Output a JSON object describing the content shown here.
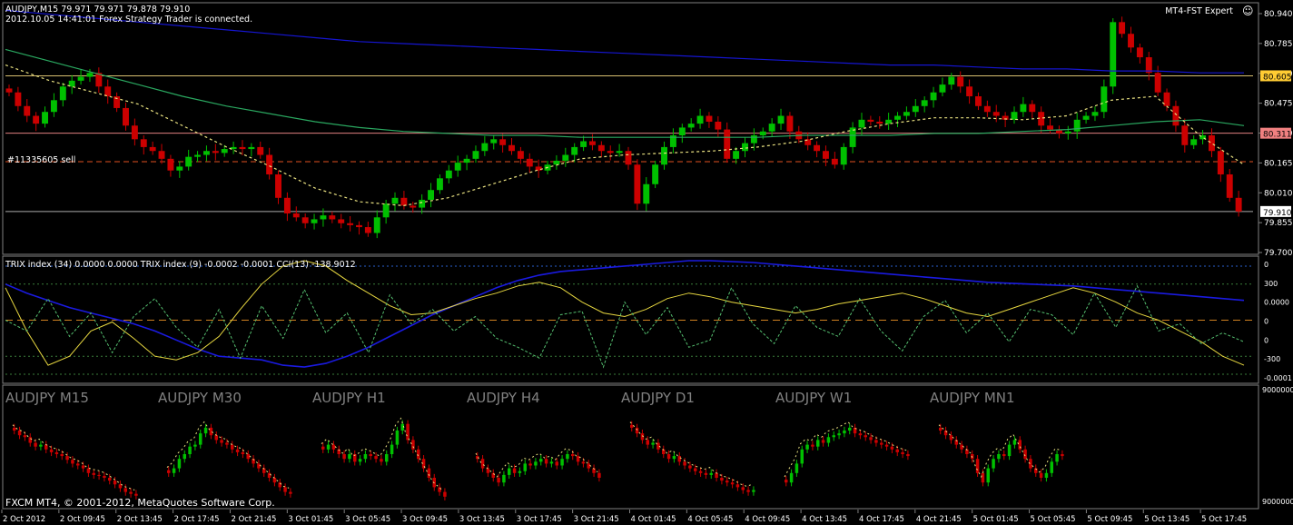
{
  "header": {
    "symbol_line": "AUDJPY,M15  79.971 79.971 79.878 79.910",
    "status_line": "2012.10.05 14:41:01 Forex Strategy Trader is connected.",
    "expert_label": "MT4-FST Expert",
    "smiley": "☺"
  },
  "chart_data": [
    {
      "type": "candlestick",
      "symbol": "AUDJPY",
      "timeframe": "M15",
      "price_axis": {
        "ylim": [
          79.7,
          80.97
        ],
        "ticks": [
          "80.940",
          "80.785",
          "80.630",
          "80.475",
          "80.320",
          "80.165",
          "80.010",
          "79.855",
          "79.700"
        ]
      },
      "price_tags": [
        {
          "value": "80.605",
          "color": "#ffcc33",
          "text_color": "#000000"
        },
        {
          "value": "80.311",
          "color": "#f08080",
          "text_color": "#000000"
        },
        {
          "value": "79.910",
          "color": "#ffffff",
          "text_color": "#000000"
        }
      ],
      "hlines": [
        {
          "price": 80.605,
          "color": "#d8c070"
        },
        {
          "price": 80.311,
          "color": "#e08080"
        },
        {
          "price": 80.165,
          "color": "#e05020",
          "dashed": true
        },
        {
          "price": 79.91,
          "color": "#aaaaaa"
        }
      ],
      "order_label": "#11335605 sell",
      "colors": {
        "up": "#00c000",
        "down": "#cc0000",
        "ma_slow": "#1515d0",
        "ma_mid": "#2aa860",
        "ma_fast": "#e8e080"
      },
      "bars_close": [
        80.52,
        80.45,
        80.4,
        80.36,
        80.42,
        80.48,
        80.55,
        80.58,
        80.6,
        80.62,
        80.55,
        80.5,
        80.44,
        80.35,
        80.28,
        80.24,
        80.22,
        80.18,
        80.12,
        80.14,
        80.19,
        80.2,
        80.22,
        80.21,
        80.23,
        80.24,
        80.23,
        80.24,
        80.2,
        80.1,
        79.98,
        79.9,
        79.88,
        79.85,
        79.87,
        79.89,
        79.87,
        79.85,
        79.84,
        79.83,
        79.8,
        79.88,
        79.95,
        79.98,
        79.94,
        79.93,
        79.97,
        80.02,
        80.08,
        80.12,
        80.16,
        80.18,
        80.22,
        80.26,
        80.28,
        80.25,
        80.22,
        80.18,
        80.14,
        80.12,
        80.15,
        80.17,
        80.2,
        80.24,
        80.27,
        80.25,
        80.22,
        80.21,
        80.22,
        80.15,
        79.95,
        80.05,
        80.15,
        80.24,
        80.3,
        80.34,
        80.36,
        80.4,
        80.37,
        80.33,
        80.18,
        80.22,
        80.26,
        80.3,
        80.32,
        80.36,
        80.4,
        80.32,
        80.28,
        80.25,
        80.22,
        80.18,
        80.15,
        80.24,
        80.34,
        80.38,
        80.37,
        80.36,
        80.38,
        80.4,
        80.42,
        80.45,
        80.48,
        80.52,
        80.56,
        80.6,
        80.55,
        80.5,
        80.45,
        80.42,
        80.4,
        80.38,
        80.42,
        80.46,
        80.42,
        80.35,
        80.33,
        80.31,
        80.32,
        80.38,
        80.4,
        80.42,
        80.55,
        80.88,
        80.82,
        80.75,
        80.7,
        80.62,
        80.52,
        80.45,
        80.35,
        80.25,
        80.28,
        80.3,
        80.22,
        80.1,
        79.98,
        79.91
      ],
      "ma_slow": [
        80.94,
        80.92,
        80.9,
        80.88,
        80.86,
        80.84,
        80.82,
        80.8,
        80.78,
        80.77,
        80.76,
        80.75,
        80.74,
        80.73,
        80.72,
        80.71,
        80.7,
        80.69,
        80.68,
        80.67,
        80.66,
        80.66,
        80.65,
        80.64,
        80.64,
        80.63,
        80.63,
        80.62,
        80.62
      ],
      "ma_mid": [
        80.74,
        80.68,
        80.62,
        80.56,
        80.5,
        80.45,
        80.41,
        80.37,
        80.34,
        80.32,
        80.31,
        80.3,
        80.3,
        80.29,
        80.29,
        80.29,
        80.29,
        80.29,
        80.3,
        80.3,
        80.3,
        80.31,
        80.31,
        80.32,
        80.33,
        80.35,
        80.37,
        80.38,
        80.35
      ],
      "ma_fast": [
        80.66,
        80.58,
        80.52,
        80.46,
        80.35,
        80.24,
        80.14,
        80.03,
        79.96,
        79.94,
        79.98,
        80.05,
        80.12,
        80.18,
        80.2,
        80.21,
        80.22,
        80.24,
        80.27,
        80.32,
        80.36,
        80.39,
        80.39,
        80.38,
        80.4,
        80.48,
        80.5,
        80.3,
        80.15
      ]
    },
    {
      "type": "line",
      "title": "TRIX index (34) 0.0000 0.0000  TRIX index (9) -0.0002 -0.0001  CCI(13) -138.9012",
      "right_axis_labels": [
        "0",
        "300",
        "0.0000",
        "0",
        "0",
        "-300",
        "-0.0001"
      ],
      "levels": [
        300,
        200,
        0,
        -200,
        -300
      ],
      "ylim": [
        -340,
        340
      ],
      "series": [
        {
          "name": "TRIX index (34)",
          "color": "#1a1ae0",
          "values": [
            200,
            150,
            110,
            70,
            40,
            10,
            -20,
            -60,
            -110,
            -160,
            -200,
            -210,
            -220,
            -250,
            -260,
            -240,
            -200,
            -150,
            -90,
            -30,
            30,
            80,
            130,
            180,
            220,
            250,
            270,
            280,
            290,
            300,
            310,
            320,
            330,
            330,
            325,
            320,
            310,
            300,
            290,
            280,
            270,
            260,
            250,
            240,
            230,
            220,
            210,
            205,
            200,
            195,
            190,
            180,
            170,
            160,
            150,
            140,
            130,
            120,
            110
          ]
        },
        {
          "name": "TRIX index (9)",
          "color": "#e8d840",
          "values": [
            180,
            -60,
            -250,
            -200,
            -60,
            -10,
            -100,
            -200,
            -220,
            -180,
            -90,
            60,
            200,
            300,
            330,
            300,
            220,
            150,
            80,
            30,
            40,
            80,
            120,
            150,
            190,
            210,
            180,
            100,
            40,
            20,
            60,
            120,
            150,
            130,
            100,
            80,
            60,
            40,
            60,
            90,
            110,
            130,
            150,
            120,
            80,
            40,
            20,
            60,
            100,
            140,
            180,
            150,
            100,
            40,
            0,
            -60,
            -120,
            -200,
            -250
          ]
        },
        {
          "name": "CCI(13)",
          "color": "#55c070",
          "values": [
            0,
            -60,
            120,
            -90,
            40,
            -180,
            20,
            120,
            -40,
            -150,
            60,
            -210,
            80,
            -100,
            170,
            -70,
            40,
            -180,
            140,
            -20,
            60,
            -60,
            20,
            -100,
            -150,
            -210,
            30,
            50,
            -260,
            100,
            -80,
            70,
            -150,
            -110,
            180,
            -20,
            -130,
            80,
            -40,
            -90,
            120,
            -60,
            -170,
            20,
            110,
            -70,
            40,
            -120,
            60,
            30,
            -80,
            150,
            -40,
            190,
            -60,
            -20,
            -130,
            -70,
            -120
          ]
        }
      ]
    },
    {
      "type": "candlestick",
      "title": "Multi-timeframe minicharts",
      "right_axis_labels": [
        "9000000",
        "9000000"
      ],
      "panels": [
        {
          "name": "AUDJPY M15",
          "closes": [
            0.75,
            0.7,
            0.68,
            0.62,
            0.58,
            0.6,
            0.55,
            0.52,
            0.5,
            0.48,
            0.44,
            0.4,
            0.38,
            0.35,
            0.3,
            0.28,
            0.27,
            0.25,
            0.22,
            0.18,
            0.14,
            0.1,
            0.08,
            0.06
          ]
        },
        {
          "name": "AUDJPY M30",
          "closes": [
            0.3,
            0.35,
            0.45,
            0.5,
            0.58,
            0.6,
            0.72,
            0.78,
            0.7,
            0.65,
            0.62,
            0.6,
            0.55,
            0.52,
            0.5,
            0.45,
            0.4,
            0.35,
            0.3,
            0.25,
            0.2,
            0.15,
            0.1,
            0.08
          ]
        },
        {
          "name": "AUDJPY H1",
          "closes": [
            0.55,
            0.6,
            0.55,
            0.5,
            0.45,
            0.5,
            0.42,
            0.45,
            0.5,
            0.48,
            0.45,
            0.42,
            0.5,
            0.6,
            0.75,
            0.82,
            0.65,
            0.55,
            0.45,
            0.35,
            0.25,
            0.15,
            0.1,
            0.05
          ]
        },
        {
          "name": "AUDJPY H4",
          "closes": [
            0.45,
            0.35,
            0.3,
            0.25,
            0.2,
            0.28,
            0.35,
            0.3,
            0.32,
            0.4,
            0.38,
            0.42,
            0.45,
            0.4,
            0.42,
            0.38,
            0.45,
            0.5,
            0.48,
            0.42,
            0.4,
            0.35,
            0.3,
            0.25
          ]
        },
        {
          "name": "AUDJPY D1",
          "closes": [
            0.78,
            0.72,
            0.65,
            0.6,
            0.62,
            0.55,
            0.5,
            0.45,
            0.48,
            0.42,
            0.38,
            0.35,
            0.32,
            0.3,
            0.28,
            0.3,
            0.25,
            0.22,
            0.2,
            0.18,
            0.15,
            0.12,
            0.1,
            0.12
          ]
        },
        {
          "name": "AUDJPY W1",
          "closes": [
            0.2,
            0.3,
            0.4,
            0.55,
            0.6,
            0.58,
            0.65,
            0.62,
            0.68,
            0.7,
            0.72,
            0.75,
            0.78,
            0.72,
            0.7,
            0.68,
            0.65,
            0.62,
            0.6,
            0.58,
            0.55,
            0.52,
            0.5,
            0.48
          ]
        },
        {
          "name": "AUDJPY MN1",
          "closes": [
            0.75,
            0.7,
            0.65,
            0.6,
            0.55,
            0.5,
            0.45,
            0.3,
            0.2,
            0.35,
            0.45,
            0.5,
            0.48,
            0.6,
            0.65,
            0.55,
            0.45,
            0.35,
            0.3,
            0.25,
            0.3,
            0.42,
            0.5,
            0.48
          ]
        }
      ]
    }
  ],
  "x_axis": {
    "labels": [
      "2 Oct 2012",
      "2 Oct 09:45",
      "2 Oct 13:45",
      "2 Oct 17:45",
      "2 Oct 21:45",
      "3 Oct 01:45",
      "3 Oct 05:45",
      "3 Oct 09:45",
      "3 Oct 13:45",
      "3 Oct 17:45",
      "3 Oct 21:45",
      "4 Oct 01:45",
      "4 Oct 05:45",
      "4 Oct 09:45",
      "4 Oct 13:45",
      "4 Oct 17:45",
      "4 Oct 21:45",
      "5 Oct 01:45",
      "5 Oct 05:45",
      "5 Oct 09:45",
      "5 Oct 13:45",
      "5 Oct 17:45"
    ]
  },
  "footer": {
    "copyright": "FXCM MT4, © 2001-2012, MetaQuotes Software Corp."
  }
}
